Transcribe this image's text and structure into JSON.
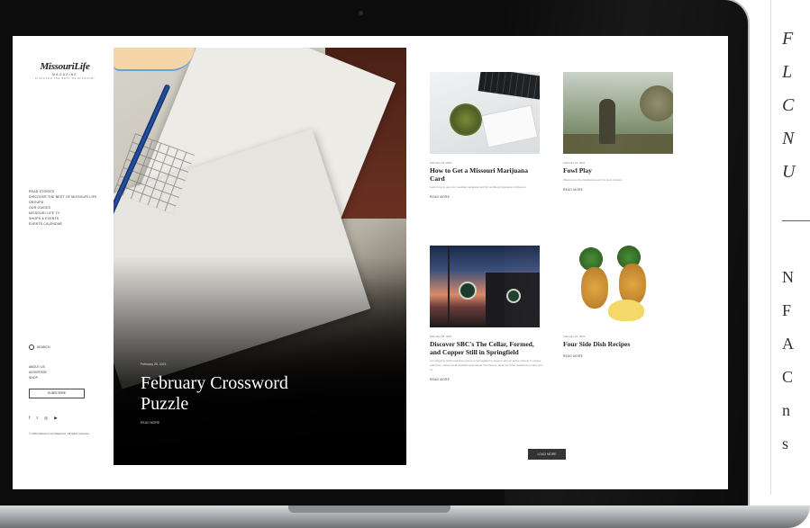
{
  "side_panel": {
    "letters_top": [
      "F",
      "L",
      "C",
      "N",
      "U"
    ],
    "letters_bottom": [
      "N",
      "F",
      "A",
      "C",
      "n",
      "s"
    ]
  },
  "logo": {
    "name": "MissouriLife",
    "sub": "MAGAZINE",
    "tagline": "DISCOVER THE BEST OF MISSOURI"
  },
  "nav": {
    "items": [
      "Read stories",
      "Discover the best of Missouri life groups",
      "Our guides",
      "Missouri life TV",
      "Shops & events",
      "Events calendar"
    ],
    "search_label": "Search",
    "footer_items": [
      "About us",
      "Advertise",
      "Shop"
    ],
    "subscribe_label": "Subscribe",
    "social": [
      "f",
      "t",
      "◎",
      "▶"
    ],
    "copyright": "© 2021 Missouri Life Magazine. All rights reserved."
  },
  "hero": {
    "date": "February 25, 2021",
    "title": "February Crossword Puzzle",
    "read_more": "Read more"
  },
  "articles": [
    {
      "date": "February 13, 2021",
      "title": "How to Get a Missouri Marijuana Card",
      "excerpt": "Learn how to get your medical marijuana card for certified physicians in Missouri.",
      "more": "Read more"
    },
    {
      "date": "February 15, 2021",
      "title": "Fowl Play",
      "excerpt": "Welcome to the traditional event for duck hunters.",
      "more": "Read more"
    },
    {
      "date": "February 15, 2021",
      "title": "Discover SBC's The Cellar, Formed, and Copper Still in Springfield",
      "excerpt": "An intriguing spirits and brew scene in Springfield for anyone with an active interest in unique craft beer, classic local cocktails and unique new flavors. Here are three standouts to stop and try.",
      "more": "Read more"
    },
    {
      "date": "February 15, 2021",
      "title": "Four Side Dish Recipes",
      "excerpt": "",
      "more": "Read more"
    }
  ],
  "load_more_label": "Load more"
}
